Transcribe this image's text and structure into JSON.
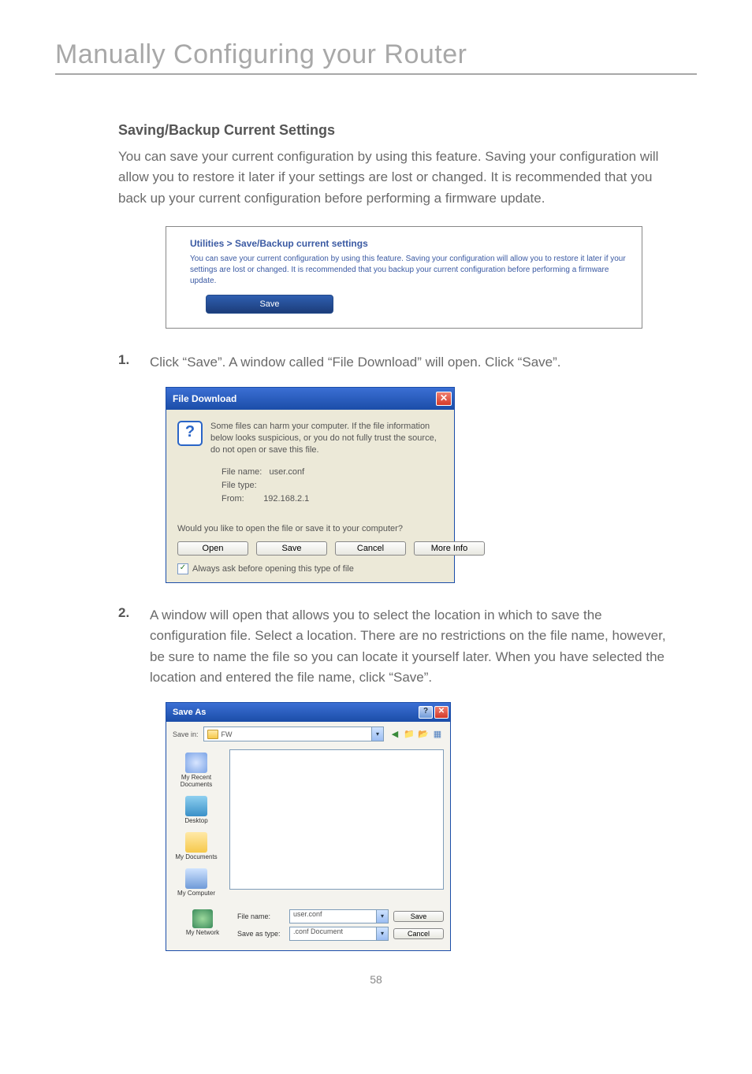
{
  "page": {
    "title": "Manually Configuring your Router",
    "number": "58"
  },
  "section": {
    "heading": "Saving/Backup Current Settings",
    "intro": "You can save your current configuration by using this feature. Saving your configuration will allow you to restore it later if your settings are lost or changed. It is recommended that you back up your current configuration before performing a firmware update."
  },
  "utilities": {
    "title": "Utilities > Save/Backup current settings",
    "desc": "You can save your current configuration by using this feature. Saving your configuration will allow you to restore it later if your settings are lost or changed. It is recommended that you backup your current configuration before performing a firmware update.",
    "save": "Save"
  },
  "steps": {
    "s1_num": "1.",
    "s1_text": "Click “Save”. A window called “File Download” will open. Click “Save”.",
    "s2_num": "2.",
    "s2_text": "A window will open that allows you to select the location in which to save the configuration file. Select a location. There are no restrictions on the file name, however, be sure to name the file so you can locate it yourself later. When you have selected the location and entered the file name, click “Save”."
  },
  "file_download": {
    "title": "File Download",
    "close": "✕",
    "msg": "Some files can harm your computer. If the file information below looks suspicious, or you do not fully trust the source, do not open or save this file.",
    "file_name_label": "File name:",
    "file_name_value": "user.conf",
    "file_type_label": "File type:",
    "file_type_value": "",
    "from_label": "From:",
    "from_value": "192.168.2.1",
    "prompt": "Would you like to open the file or save it to your computer?",
    "btn_open": "Open",
    "btn_save": "Save",
    "btn_cancel": "Cancel",
    "btn_more": "More Info",
    "checkbox_label": "Always ask before opening this type of file"
  },
  "save_as": {
    "title": "Save As",
    "help": "?",
    "close": "✕",
    "save_in_label": "Save in:",
    "save_in_value": "FW",
    "places": {
      "recent": "My Recent Documents",
      "desktop": "Desktop",
      "mydocs": "My Documents",
      "mycomp": "My Computer",
      "mynet": "My Network"
    },
    "file_name_label": "File name:",
    "file_name_value": "user.conf",
    "save_as_type_label": "Save as type:",
    "save_as_type_value": ".conf Document",
    "btn_save": "Save",
    "btn_cancel": "Cancel"
  }
}
